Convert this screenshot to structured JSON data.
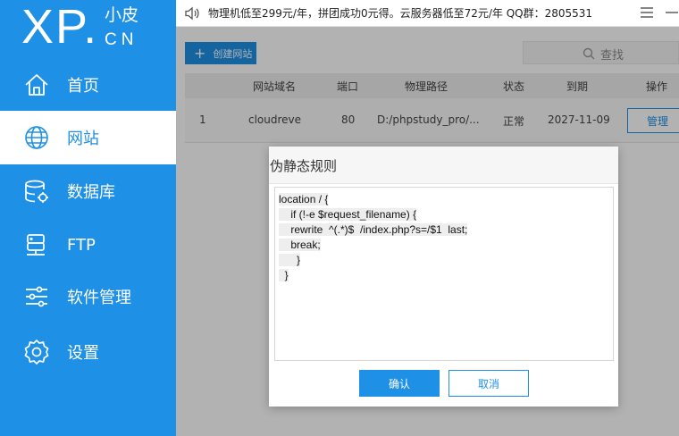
{
  "logo": {
    "brand": "XP.",
    "small": "小皮",
    "cn": "CN"
  },
  "sidebar": {
    "items": [
      {
        "label": "首页",
        "icon": "home-icon"
      },
      {
        "label": "网站",
        "icon": "globe-icon",
        "active": true
      },
      {
        "label": "数据库",
        "icon": "database-icon"
      },
      {
        "label": "FTP",
        "icon": "server-icon"
      },
      {
        "label": "软件管理",
        "icon": "sliders-icon"
      },
      {
        "label": "设置",
        "icon": "gear-icon"
      }
    ]
  },
  "topbar": {
    "notice": "物理机低至299元/年，拼团成功0元得。云服务器低至72元/年   QQ群：2805531",
    "icons": [
      "speaker-icon",
      "menu-icon",
      "minimize-icon"
    ]
  },
  "toolbar": {
    "create_label": "创建网站",
    "create_icon": "+",
    "search_placeholder": "查找"
  },
  "table": {
    "columns": [
      "网站域名",
      "端口",
      "物理路径",
      "状态",
      "到期",
      "操作"
    ],
    "rows": [
      {
        "index": "1",
        "domain": "cloudreve",
        "port": "80",
        "path": "D:/phpstudy_pro/...",
        "status": "正常",
        "expiry": "2027-11-09",
        "action": "管理"
      }
    ]
  },
  "modal": {
    "title": "伪静态规则",
    "code_lines": [
      "location / {",
      "    if (!-e $request_filename) {",
      "    rewrite  ^(.*)$  /index.php?s=/$1  last;",
      "    break;",
      "      }",
      "  }"
    ],
    "ok_label": "确认",
    "cancel_label": "取消"
  },
  "colors": {
    "accent": "#1e90e6"
  }
}
